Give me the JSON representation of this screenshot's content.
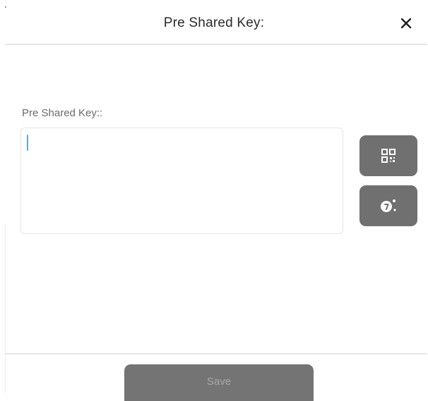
{
  "dialog": {
    "title": "Pre Shared Key:",
    "close_icon": "close-icon"
  },
  "form": {
    "label": "Pre Shared Key::",
    "input_value": "",
    "input_placeholder": ""
  },
  "actions": {
    "scan_qr_icon": "qr-code-icon",
    "generate_key_icon": "key-generate-icon",
    "save_label": "Save"
  },
  "colors": {
    "button_gray": "#707070",
    "caret_blue": "#5aa7f0",
    "divider": "#e6e6e6"
  }
}
